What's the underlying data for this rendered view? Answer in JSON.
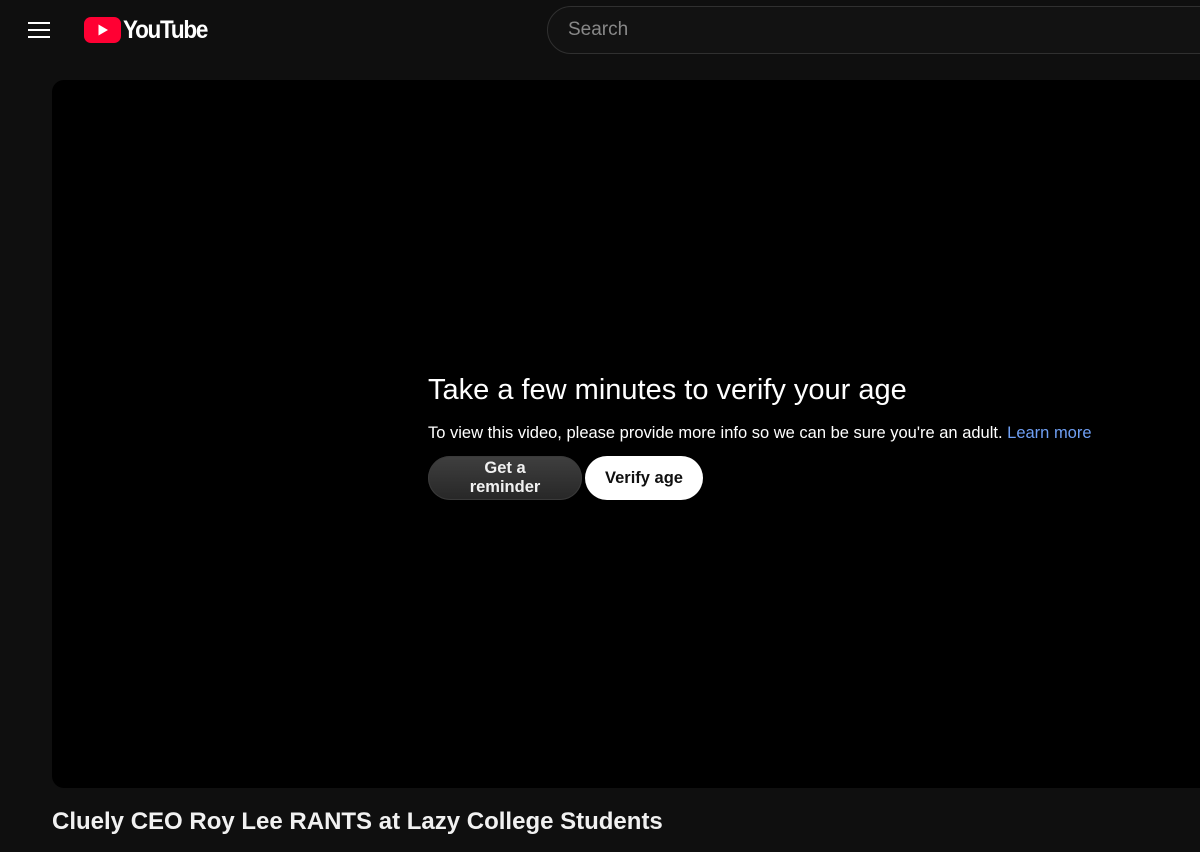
{
  "header": {
    "logo_text": "YouTube",
    "search": {
      "placeholder": "Search",
      "value": ""
    }
  },
  "player": {
    "age_gate": {
      "title": "Take a few minutes to verify your age",
      "description": "To view this video, please provide more info so we can be sure you're an adult.",
      "learn_more": "Learn more",
      "reminder_button": "Get a reminder",
      "verify_button": "Verify age"
    }
  },
  "video": {
    "title": "Cluely CEO Roy Lee RANTS at Lazy College Students"
  },
  "icons": {
    "menu": "hamburger-menu-icon",
    "logo": "youtube-logo-icon"
  },
  "colors": {
    "brand_red": "#ff0033",
    "link_blue": "#6f9ff3",
    "background": "#0f0f0f"
  }
}
